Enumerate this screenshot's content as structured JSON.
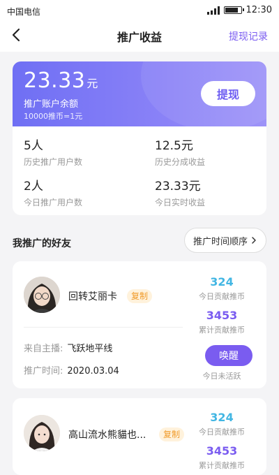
{
  "status_bar": {
    "carrier": "中国电信",
    "time": "12:30"
  },
  "nav": {
    "title": "推广收益",
    "right_link": "提现记录"
  },
  "earnings": {
    "amount": "23.33",
    "unit": "元",
    "label": "推广账户余额",
    "rate": "10000推币=1元",
    "withdraw_button": "提现",
    "stats": [
      {
        "value": "5人",
        "label": "历史推广用户数"
      },
      {
        "value": "12.5元",
        "label": "历史分成收益"
      },
      {
        "value": "2人",
        "label": "今日推广用户数"
      },
      {
        "value": "23.33元",
        "label": "今日实时收益"
      }
    ]
  },
  "friends_section": {
    "title": "我推广的好友",
    "sort_button": "推广时间顺序"
  },
  "friends": [
    {
      "name": "回转艾丽卡",
      "copy_label": "复制",
      "today_coins": "324",
      "today_coins_label": "今日贡献推币",
      "total_coins": "3453",
      "total_coins_label": "累计贡献推币",
      "source_label": "来自主播:",
      "source_value": "飞跃地平线",
      "time_label": "推广时间:",
      "time_value": "2020.03.04",
      "action_button": "唤醒",
      "action_status": "今日未活跃"
    },
    {
      "name": "高山流水熊貓也...",
      "copy_label": "复制",
      "today_coins": "324",
      "today_coins_label": "今日贡献推币",
      "total_coins": "3453",
      "total_coins_label": "累计贡献推币"
    }
  ],
  "icons": {
    "back": "chevron-left-icon",
    "sort": "chevron-right-icon",
    "signal": "signal-icon",
    "battery": "battery-icon"
  },
  "colors": {
    "accent": "#7a5cf0",
    "card_gradient_start": "#6f6ff4",
    "blue_number": "#42b6e3",
    "tag_bg": "#fff2dc",
    "tag_text": "#f09b2a"
  }
}
